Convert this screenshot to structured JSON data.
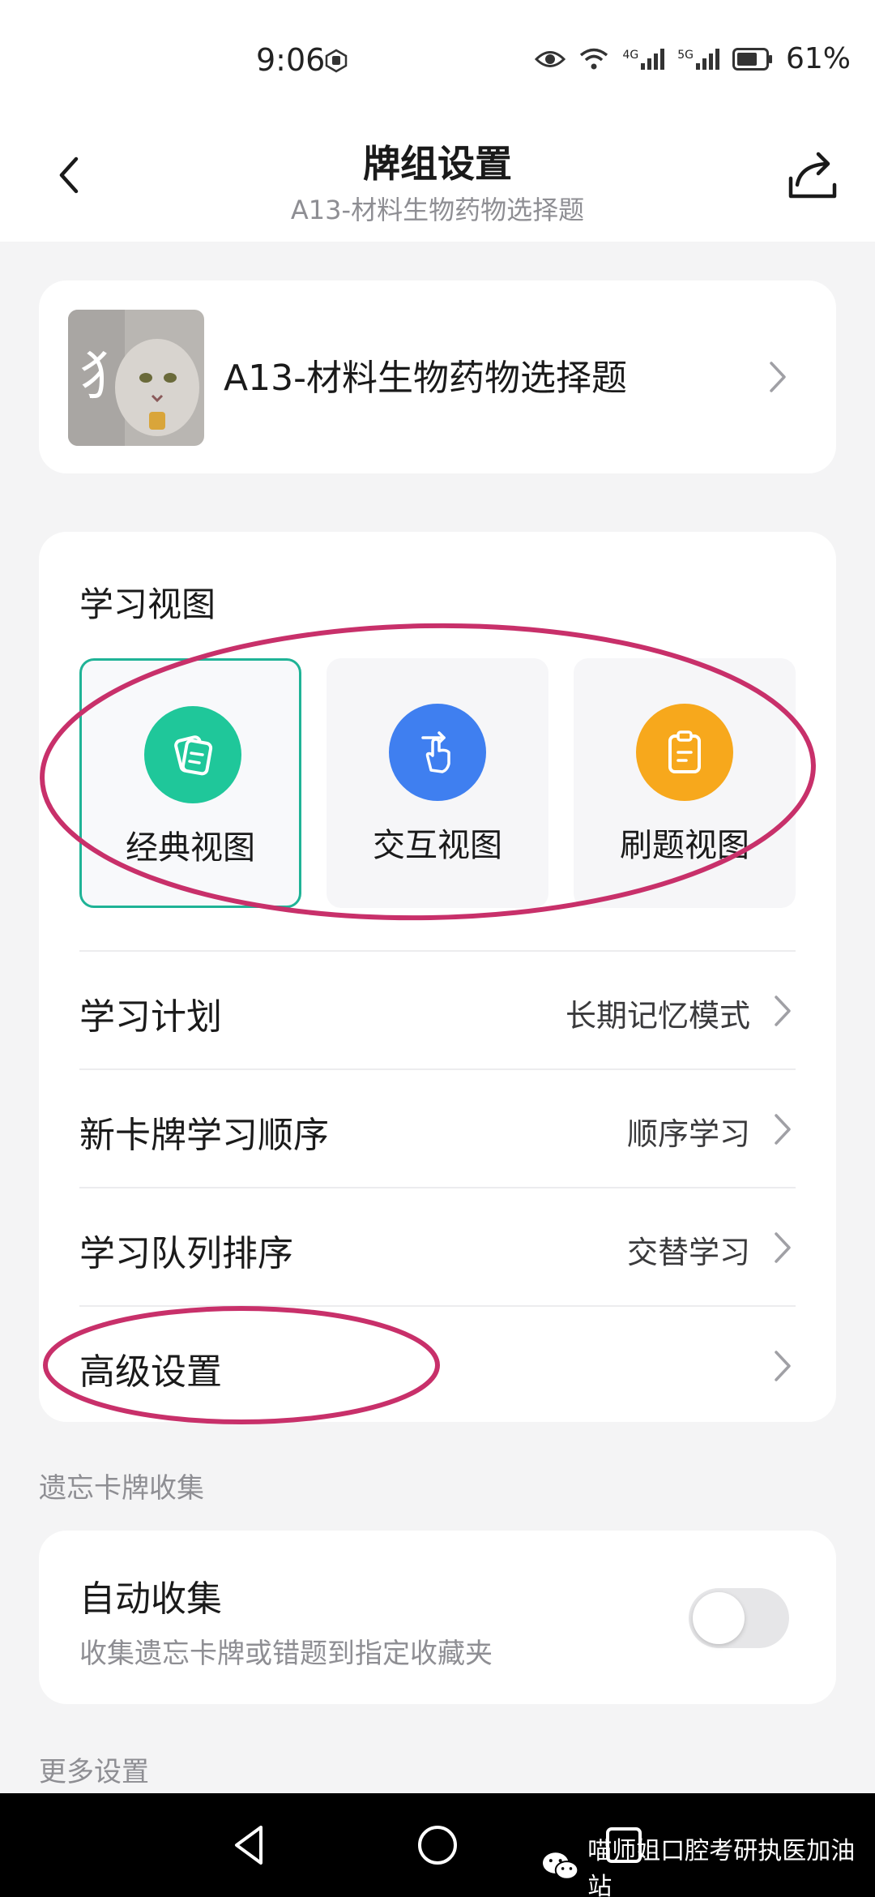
{
  "status_bar": {
    "time": "9:06",
    "network_1": "4G",
    "network_2": "5G",
    "battery": "61%"
  },
  "header": {
    "title": "牌组设置",
    "subtitle": "A13-材料生物药物选择题"
  },
  "deck": {
    "name": "A13-材料生物药物选择题"
  },
  "study_view": {
    "title": "学习视图",
    "options": [
      {
        "label": "经典视图",
        "icon": "cards-icon",
        "color": "#1fc79a",
        "selected": true
      },
      {
        "label": "交互视图",
        "icon": "tap-icon",
        "color": "#3f7ff0",
        "selected": false
      },
      {
        "label": "刷题视图",
        "icon": "clipboard-icon",
        "color": "#f7a81c",
        "selected": false
      }
    ]
  },
  "rows": [
    {
      "label": "学习计划",
      "value": "长期记忆模式"
    },
    {
      "label": "新卡牌学习顺序",
      "value": "顺序学习"
    },
    {
      "label": "学习队列排序",
      "value": "交替学习"
    },
    {
      "label": "高级设置",
      "value": ""
    }
  ],
  "forgotten": {
    "group_label": "遗忘卡牌收集",
    "title": "自动收集",
    "description": "收集遗忘卡牌或错题到指定收藏夹",
    "toggle_on": false
  },
  "more": {
    "group_label": "更多设置"
  },
  "watermark": "喵师姐口腔考研执医加油站",
  "colors": {
    "accent": "#1fb396",
    "annotation": "#c8306a"
  }
}
